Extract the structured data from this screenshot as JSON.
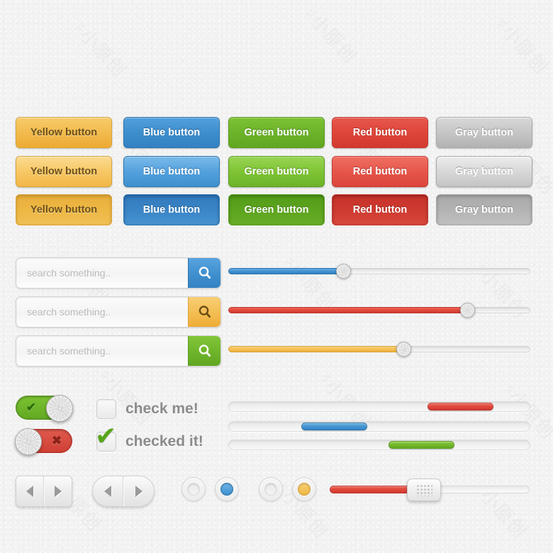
{
  "buttons": {
    "columns": [
      {
        "color_name": "yellow",
        "label": "Yellow button",
        "hex": "#f2bb4e"
      },
      {
        "color_name": "blue",
        "label": "Blue button",
        "hex": "#3e8ecd"
      },
      {
        "color_name": "green",
        "label": "Green button",
        "hex": "#6db32a"
      },
      {
        "color_name": "red",
        "label": "Red button",
        "hex": "#de4639"
      },
      {
        "color_name": "gray",
        "label": "Gray button",
        "hex": "#c6c6c6"
      }
    ],
    "states": [
      "normal",
      "hover",
      "pressed"
    ]
  },
  "search_fields": [
    {
      "placeholder": "search something..",
      "value": "",
      "button_color": "blue",
      "icon": "search-icon",
      "hex": "#3f90ce"
    },
    {
      "placeholder": "search something..",
      "value": "",
      "button_color": "yellow",
      "icon": "search-icon",
      "hex": "#f3bd52"
    },
    {
      "placeholder": "search something..",
      "value": "",
      "button_color": "green",
      "icon": "search-icon",
      "hex": "#6eb42b"
    }
  ],
  "sliders": [
    {
      "color": "blue",
      "value": 38,
      "hex": "#3f90ce"
    },
    {
      "color": "red",
      "value": 79,
      "hex": "#de4639"
    },
    {
      "color": "yellow",
      "value": 58,
      "hex": "#f3bd52"
    }
  ],
  "toggles": [
    {
      "state": "on",
      "icon": "check-icon",
      "glyph": "✔",
      "color": "green",
      "hex": "#63a922"
    },
    {
      "state": "off",
      "icon": "cross-icon",
      "glyph": "✖",
      "color": "red",
      "hex": "#cf3f34"
    }
  ],
  "checkboxes": [
    {
      "label": "check me!",
      "checked": false,
      "glyph": ""
    },
    {
      "label": "checked it!",
      "checked": true,
      "glyph": "✔"
    }
  ],
  "scrollbars": [
    {
      "color": "red",
      "start": 66,
      "end": 88,
      "hex": "#de4639"
    },
    {
      "color": "blue",
      "start": 24,
      "end": 46,
      "hex": "#4394d1"
    },
    {
      "color": "green",
      "start": 53,
      "end": 75,
      "hex": "#72b62c"
    }
  ],
  "pagers": [
    {
      "shape": "rect",
      "prev_icon": "arrow-left-icon",
      "next_icon": "arrow-right-icon"
    },
    {
      "shape": "pill",
      "prev_icon": "arrow-left-icon",
      "next_icon": "arrow-right-icon"
    }
  ],
  "radios": [
    {
      "selected": false,
      "color": "none",
      "hex": "#eaeaea"
    },
    {
      "selected": true,
      "color": "blue",
      "hex": "#3d8fd0"
    },
    {
      "selected": false,
      "color": "none",
      "hex": "#eaeaea"
    },
    {
      "selected": true,
      "color": "yellow",
      "hex": "#efb63f"
    }
  ],
  "grip_slider": {
    "color": "red",
    "value": 47,
    "hex": "#de4639",
    "handle_icon": "grip-dots-icon"
  },
  "theme": {
    "background_hex": "#f2f2f2",
    "placeholder_hex": "#b9b9b9",
    "label_hex": "#8b8b8b"
  }
}
